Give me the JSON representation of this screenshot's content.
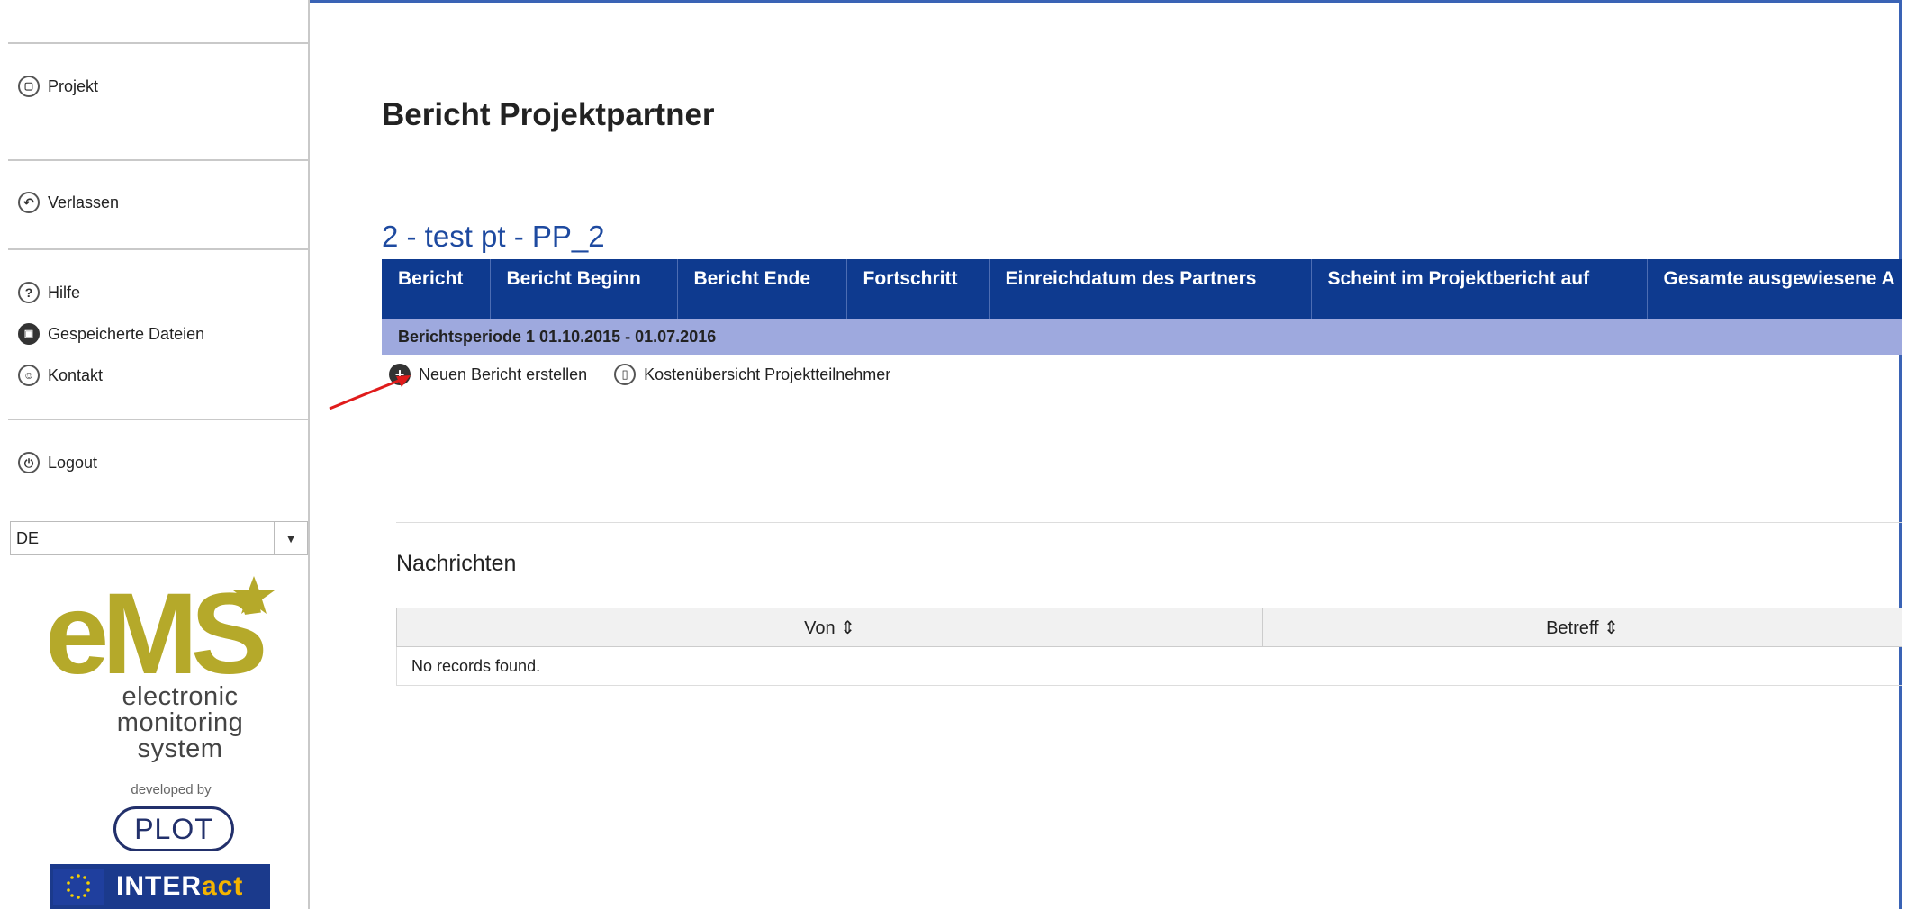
{
  "sidebar": {
    "items": [
      {
        "label": "Projekt",
        "icon": "project-icon"
      },
      {
        "label": "Verlassen",
        "icon": "back-icon"
      },
      {
        "label": "Hilfe",
        "icon": "help-icon"
      },
      {
        "label": "Gespeicherte Dateien",
        "icon": "save-icon"
      },
      {
        "label": "Kontakt",
        "icon": "contact-icon"
      },
      {
        "label": "Logout",
        "icon": "power-icon"
      }
    ],
    "language": "DE",
    "logo_text": "eMS",
    "logo_subtitle": [
      "electronic",
      "monitoring",
      "system"
    ],
    "developed_by": "developed by",
    "plot_logo": "PLOT",
    "interact_logo": {
      "part1": "INTER",
      "part2": "act"
    }
  },
  "main": {
    "page_title": "Bericht Projektpartner",
    "project_title": "2 - test pt - PP_2",
    "report_table": {
      "columns": [
        "Bericht",
        "Bericht Beginn",
        "Bericht Ende",
        "Fortschritt",
        "Einreichdatum des Partners",
        "Scheint im Projektbericht auf",
        "Gesamte ausgewiesene A"
      ],
      "period_row": "Berichtsperiode 1 01.10.2015 - 01.07.2016"
    },
    "actions": {
      "new_report": "Neuen Bericht erstellen",
      "cost_overview": "Kostenübersicht Projektteilnehmer"
    },
    "messages": {
      "title": "Nachrichten",
      "columns": [
        "Von ⇕",
        "Betreff ⇕"
      ],
      "empty_text": "No records found."
    }
  },
  "colors": {
    "header_blue": "#0e3a8f",
    "period_row": "#9ea9de",
    "title_blue": "#1e4aa0",
    "frame_border": "#3a63b5",
    "ems_green": "#b5a92a",
    "annotation_arrow": "#e01b1b"
  }
}
